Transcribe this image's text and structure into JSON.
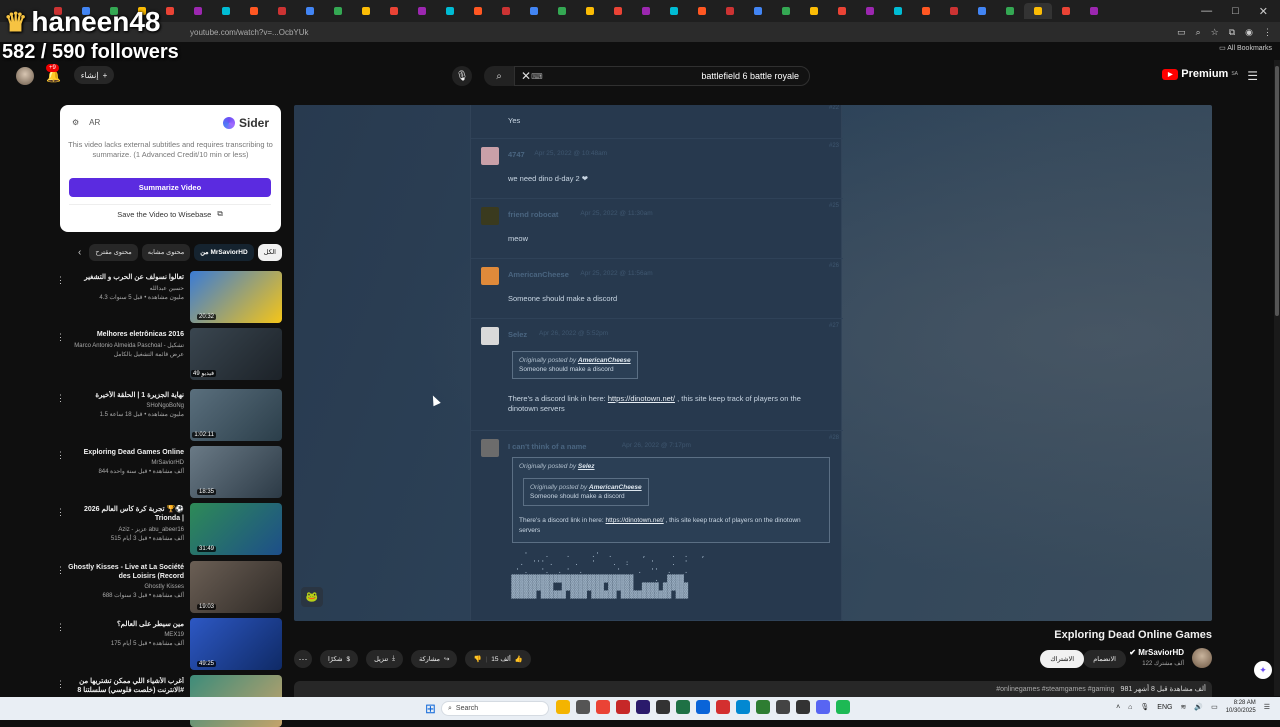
{
  "overlay": {
    "streamer": "haneen48",
    "followers": "582 / 590 followers"
  },
  "browser": {
    "url": "youtube.com/watch?v=...OcbYUk",
    "bookmarks": "All Bookmarks",
    "tab_count_visible": 38
  },
  "header": {
    "notif_badge": "+9",
    "create_label": "إنشاء",
    "search_query": "battlefield 6 battle royale",
    "logo_text": "Premium",
    "logo_region": "SA"
  },
  "sider": {
    "lang": "AR",
    "brand": "Sider",
    "message": "This video lacks external subtitles and requires transcribing to summarize. (1 Advanced Credit/10 min or less)",
    "summarize": "Summarize Video",
    "save": "Save the Video to Wisebase"
  },
  "chips": [
    "الكل",
    "من MrSaviorHD",
    "محتوى مشابه",
    "محتوى مقترح"
  ],
  "recommendations": [
    {
      "title": "تعالوا نسولف عن الحرب و التشغير",
      "channel": "حسين عبدالله",
      "meta": "4.3 مليون مشاهدة • قبل 5 سنوات",
      "duration": "20:32",
      "colors": [
        "#3a7bd5",
        "#f5c518"
      ]
    },
    {
      "title": "Melhores eletrônicas 2016",
      "channel": "Marco Antonio Almeida Paschoal - تشكيل",
      "meta": "عرض قائمة التشغيل بالكامل",
      "duration": "49 فيديو",
      "colors": [
        "#3a4650",
        "#1c2228"
      ]
    },
    {
      "title": "نهاية الجزيرة 1 | الحلقة الأخيرة",
      "channel": "SHoNgoBoNg",
      "meta": "1.5 مليون مشاهدة • قبل 18 ساعة",
      "duration": "1:02:11",
      "colors": [
        "#5a6f7d",
        "#2b3e4a"
      ]
    },
    {
      "title": "Exploring Dead Games Online",
      "channel": "MrSaviorHD",
      "meta": "844 ألف مشاهدة • قبل سنة واحدة",
      "duration": "18:35",
      "colors": [
        "#6a7a86",
        "#2c3a46"
      ]
    },
    {
      "title": "تجربة كرة كأس العالم 2026 🏆⚽ Trionda |",
      "channel": "Aziz - عزيز abu_abeer16",
      "meta": "515 ألف مشاهدة • قبل 3 أيام",
      "duration": "31:49",
      "colors": [
        "#2e8b57",
        "#1d4e89"
      ]
    },
    {
      "title": "Ghostly Kisses - Live at La Société des Loisirs (Record",
      "channel": "Ghostly Kisses",
      "meta": "688 ألف مشاهدة • قبل 3 سنوات",
      "duration": "19:03",
      "colors": [
        "#6b5f55",
        "#2f2a26"
      ]
    },
    {
      "title": "مين سيطر على العالم؟",
      "channel": "MEX19",
      "meta": "175 ألف مشاهدة • قبل 5 أيام",
      "duration": "49:25",
      "colors": [
        "#2d58c4",
        "#0f2a66"
      ]
    },
    {
      "title": "أغرب الأشياء اللي ممكن تشتريها من الانترنت (خلصت فلوسي) سلسلتنا 8#",
      "channel": "",
      "meta": "",
      "duration": "",
      "colors": [
        "#3d8c7a",
        "#c4a36b"
      ]
    }
  ],
  "forum": {
    "posts": [
      {
        "name": "",
        "date": "",
        "num": "#22",
        "body": "Yes",
        "avatar": "#27394e"
      },
      {
        "name": "4747",
        "date": "Apr 25, 2022 @ 10:48am",
        "num": "#23",
        "body": "we need dino d-day 2 ❤",
        "avatar": "#c9a0a8"
      },
      {
        "name": "friend robocat",
        "date": "Apr 25, 2022 @ 11:30am",
        "num": "#25",
        "body": "meow",
        "avatar": "#3a3a1e"
      },
      {
        "name": "AmericanCheese",
        "date": "Apr 25, 2022 @ 11:56am",
        "num": "#26",
        "body": "Someone should make a discord",
        "avatar": "#e08a3a"
      },
      {
        "name": "Selez",
        "date": "Apr 26, 2022 @ 5:52pm",
        "num": "#27",
        "body": "There's a discord link in here: https://dinotown.net/ , this site keep track of players on the dinotown servers",
        "avatar": "#d9d9d9"
      },
      {
        "name": "I can't think of a name",
        "date": "Apr 26, 2022 @ 7:17pm",
        "num": "#28",
        "body": "There's a discord link in here: https://dinotown.net/ , this site keep track of players on the dinotown servers",
        "avatar": "#6c6c6c"
      }
    ],
    "quote_header": "Originally posted by",
    "quote_author_1": "AmericanCheese",
    "quote_body_1": "Someone should make a discord",
    "quote_author_2": "Selez",
    "link_text": "https://dinotown.net/",
    "link_prefix": "There's a discord link in here:",
    "link_suffix": ", this site keep track of players on the dinotown servers",
    "ascii": "    '    .    .     .'  .       ,      .  .   ,\n   .  ''' .     .   '    .  :     '    .  '\n  ' .   '.  . '  .        '    .  ''  .   .\n ▓▓▓▓▓▓▓▓▓▓▓▓▓▓▓▓▓▓▓▓▓▓▓▓▓▓▓▓▓     .  ▓▓▓▓\n ▓▓▓▓▓▓▓▓▓▓  ▓▓▓▓▓▓▓▓▓▓ ▓▓▓▓▓▓  ▓▓▓▓ ▓▓▓▓▓▓\n ▓▓▓▓▓▓ ▓▓▓▓▓▓ ▓▓▓▓ ▓▓▓▓▓▓ ▓▓▓▓▓▓▓▓▓▓▓▓ ▓▓▓"
  },
  "video": {
    "title": "Exploring Dead Online Games",
    "channel": "MrSaviorHD",
    "subs": "122 ألف مشترك",
    "subscribe": "الاشتراك",
    "join": "الانضمام",
    "likes": "15 ألف",
    "share": "مشاركة",
    "download": "تنزيل",
    "thanks": "شكرًا",
    "views": "981 ألف مشاهدة قبل 8 أشهر",
    "tags": "#onlinegames #steamgames #gaming"
  },
  "taskbar": {
    "search": "Search",
    "lang": "ENG",
    "time": "8:28 AM",
    "date": "10/30/2025"
  }
}
